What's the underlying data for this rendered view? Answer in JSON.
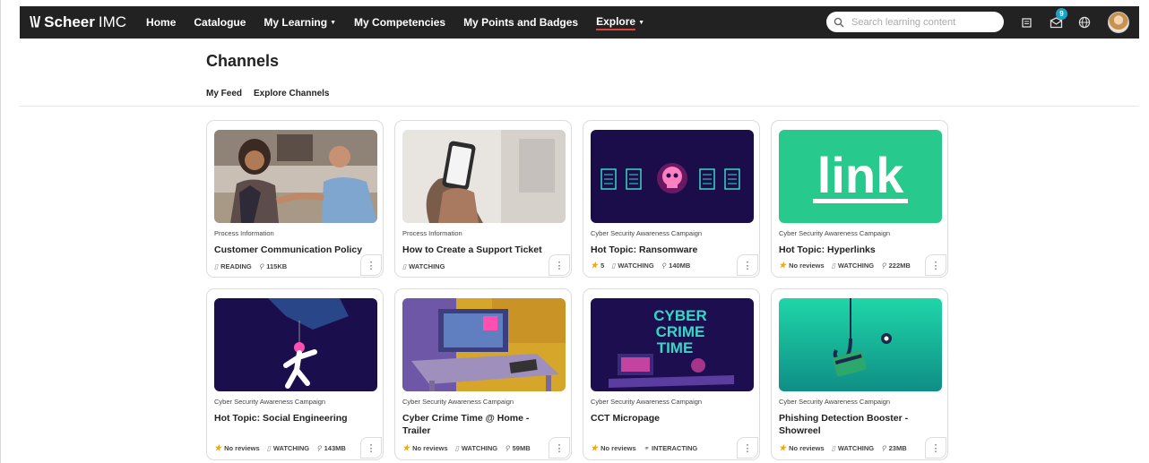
{
  "brand": {
    "mark": "\\\\/",
    "name": "Scheer",
    "name2": "IMC"
  },
  "nav": {
    "items": [
      {
        "label": "Home"
      },
      {
        "label": "Catalogue"
      },
      {
        "label": "My Learning",
        "caret": "▼"
      },
      {
        "label": "My Competencies"
      },
      {
        "label": "My Points and Badges"
      },
      {
        "label": "Explore",
        "caret": "▼"
      }
    ],
    "search_placeholder": "Search learning content",
    "notification_count": "9"
  },
  "page": {
    "title": "Channels",
    "tabs": [
      {
        "label": "My Feed"
      },
      {
        "label": "Explore Channels"
      }
    ]
  },
  "cards": [
    {
      "category": "Process Information",
      "title": "Customer Communication Policy",
      "meta": [
        {
          "icon": "▯",
          "text": "READING"
        },
        {
          "icon": "⚲",
          "text": "115KB"
        }
      ]
    },
    {
      "category": "Process Information",
      "title": "How to Create a Support Ticket",
      "meta": [
        {
          "icon": "▯",
          "text": "WATCHING"
        }
      ]
    },
    {
      "category": "Cyber Security Awareness Campaign",
      "title": "Hot Topic: Ransomware",
      "rating": "5",
      "meta": [
        {
          "icon": "▯",
          "text": "WATCHING"
        },
        {
          "icon": "⚲",
          "text": "140MB"
        }
      ]
    },
    {
      "category": "Cyber Security Awareness Campaign",
      "title": "Hot Topic: Hyperlinks",
      "rating": "No reviews",
      "meta": [
        {
          "icon": "▯",
          "text": "WATCHING"
        },
        {
          "icon": "⚲",
          "text": "222MB"
        }
      ]
    },
    {
      "category": "Cyber Security Awareness Campaign",
      "title": "Hot Topic: Social Engineering",
      "rating": "No reviews",
      "meta": [
        {
          "icon": "▯",
          "text": "WATCHING"
        },
        {
          "icon": "⚲",
          "text": "143MB"
        }
      ]
    },
    {
      "category": "Cyber Security Awareness Campaign",
      "title": "Cyber Crime Time @ Home - Trailer",
      "rating": "No reviews",
      "meta": [
        {
          "icon": "▯",
          "text": "WATCHING"
        },
        {
          "icon": "⚲",
          "text": "59MB"
        }
      ]
    },
    {
      "category": "Cyber Security Awareness Campaign",
      "title": "CCT Micropage",
      "rating": "No reviews",
      "meta": [
        {
          "icon": "⚭",
          "text": "INTERACTING"
        }
      ]
    },
    {
      "category": "Cyber Security Awareness Campaign",
      "title": "Phishing Detection Booster - Showreel",
      "rating": "No reviews",
      "meta": [
        {
          "icon": "▯",
          "text": "WATCHING"
        },
        {
          "icon": "⚲",
          "text": "23MB"
        }
      ]
    }
  ],
  "thumb_texts": {
    "link": "link",
    "cyber1": "CYBER",
    "cyber2": "CRIME",
    "cyber3": "TIME"
  },
  "kebab": "⋮",
  "colors": {
    "navbar": "#222222",
    "accent_underline": "#e0413a",
    "badge": "#1fa0c6",
    "star": "#f2a900"
  }
}
